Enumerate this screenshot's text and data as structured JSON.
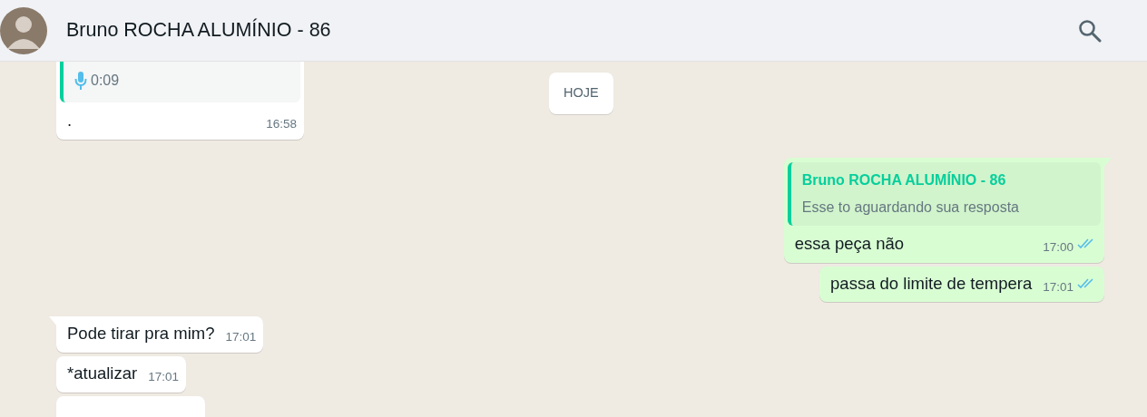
{
  "header": {
    "title": "Bruno ROCHA ALUMÍNIO - 86"
  },
  "date_chip": "HOJE",
  "messages": [
    {
      "kind": "incoming",
      "tail": false,
      "voice": {
        "duration": "0:09"
      },
      "text": ".",
      "time": "16:58"
    },
    {
      "kind": "outgoing",
      "tail": true,
      "quote": {
        "author": "Bruno ROCHA ALUMÍNIO - 86",
        "text": "Esse to aguardando sua resposta"
      },
      "text": "essa peça não",
      "time": "17:00",
      "read": true
    },
    {
      "kind": "outgoing",
      "tail": false,
      "text": "passa do limite de tempera",
      "time": "17:01",
      "read": true
    },
    {
      "kind": "incoming",
      "tail": true,
      "text": "Pode tirar pra mim?",
      "time": "17:01"
    },
    {
      "kind": "incoming",
      "tail": false,
      "text": "*atualizar",
      "time": "17:01"
    },
    {
      "kind": "incoming",
      "tail": false
    }
  ]
}
